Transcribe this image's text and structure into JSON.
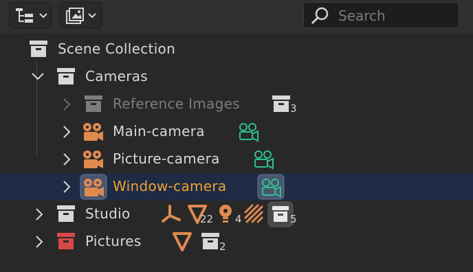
{
  "header": {
    "display_mode_icon": "outliner-tree-icon",
    "filter_icon": "image-filter-icon",
    "search": {
      "placeholder": "Search",
      "icon": "search-icon"
    }
  },
  "tree": {
    "scene_collection": {
      "label": "Scene Collection",
      "icon": "collection-icon"
    },
    "cameras": {
      "label": "Cameras",
      "icon": "collection-icon",
      "expanded": true
    },
    "reference_images": {
      "label": "Reference Images",
      "icon": "collection-icon",
      "child_count": "3"
    },
    "main_camera": {
      "label": "Main-camera",
      "icon": "camera-object-icon",
      "data_icon": "camera-data-icon"
    },
    "picture_camera": {
      "label": "Picture-camera",
      "icon": "camera-object-icon",
      "data_icon": "camera-data-icon"
    },
    "window_camera": {
      "label": "Window-camera",
      "icon": "camera-object-icon",
      "data_icon": "camera-data-icon",
      "selected": true
    },
    "studio": {
      "label": "Studio",
      "icon": "collection-icon",
      "children": {
        "empties_icon": "empty-axes-icon",
        "meshes_count": "22",
        "lights_count": "4",
        "hair_icon": "particles-icon",
        "collections_count": "5"
      }
    },
    "pictures": {
      "label": "Pictures",
      "icon": "collection-red-icon",
      "children": {
        "mesh_icon": "mesh-icon",
        "collections_count": "2"
      }
    }
  },
  "colors": {
    "background": "#282828",
    "selected_row": "#1d2b44",
    "active_text": "#f0a132",
    "object_orange": "#e08a50",
    "camera_data_green": "#2fbf8f",
    "red_collection": "#d84848"
  }
}
